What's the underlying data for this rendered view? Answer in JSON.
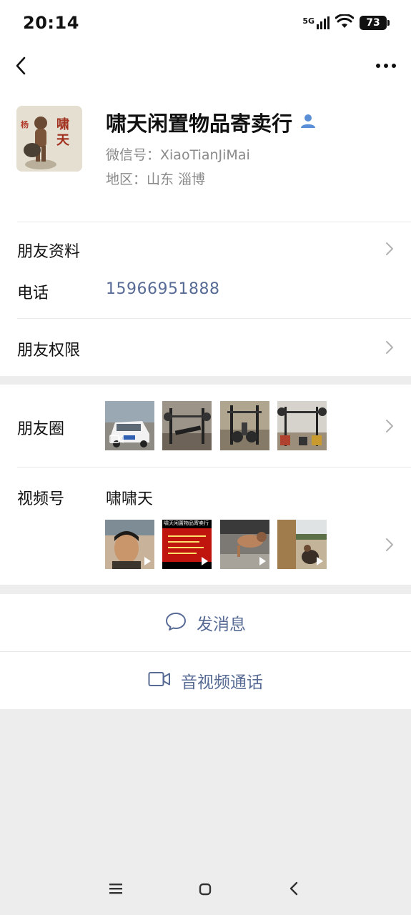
{
  "status_bar": {
    "time": "20:14",
    "network": "5G",
    "battery": "73"
  },
  "nav": {
    "back_icon": "back-chevron-icon",
    "more_icon": "more-dots-icon"
  },
  "profile": {
    "name": "啸天闲置物品寄卖行",
    "wechat_id": "微信号：XiaoTianJiMai",
    "region": "地区：山东  淄博",
    "avatar_caption": "啸天"
  },
  "rows": {
    "friend_info": "朋友资料",
    "phone_label": "电话",
    "phone_value": "15966951888",
    "permissions": "朋友权限",
    "moments": "朋友圈",
    "channels": "视频号",
    "channel_name": "啸啸天"
  },
  "channel_thumb_text": "啸天闲置物品寄卖行",
  "actions": {
    "message": "发消息",
    "call": "音视频通话"
  },
  "colors": {
    "link": "#576b95",
    "background": "#ededed"
  }
}
